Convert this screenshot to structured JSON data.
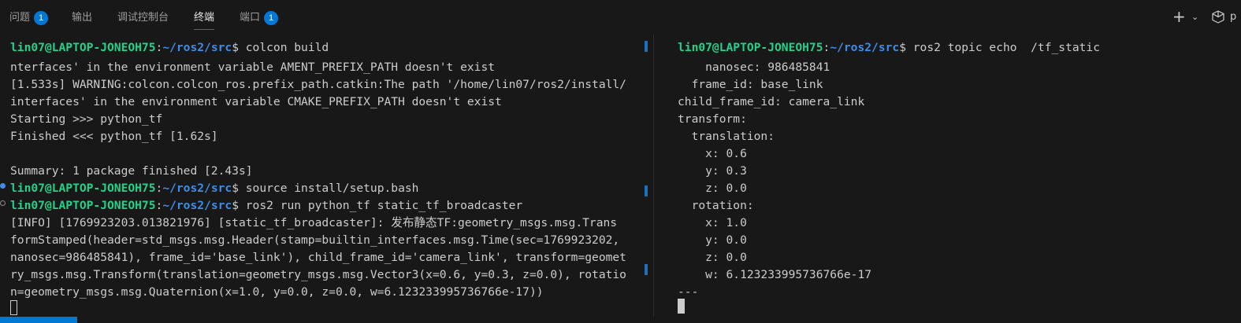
{
  "tabs": [
    {
      "label": "问题",
      "badge": "1"
    },
    {
      "label": "输出",
      "badge": null
    },
    {
      "label": "调试控制台",
      "badge": null
    },
    {
      "label": "终端",
      "badge": null,
      "active": true
    },
    {
      "label": "端口",
      "badge": "1"
    }
  ],
  "toolbar": {
    "add_icon": "plus-icon",
    "dropdown_icon": "chevron-down-icon",
    "shell_icon": "python-shell-icon",
    "truncated_label": "p"
  },
  "colors": {
    "accent": "#0078d4",
    "prompt_user": "#23d18b",
    "prompt_path": "#3b8eea",
    "bg": "#181818"
  },
  "left_terminal": {
    "prompt_header": {
      "user": "lin07@LAPTOP-JONEOH75",
      "path": "~/ros2/src",
      "symbol": "$",
      "command": " colcon build"
    },
    "lines": [
      "nterfaces' in the environment variable AMENT_PREFIX_PATH doesn't exist",
      "[1.533s] WARNING:colcon.colcon_ros.prefix_path.catkin:The path '/home/lin07/ros2/install/",
      "interfaces' in the environment variable CMAKE_PREFIX_PATH doesn't exist",
      "Starting >>> python_tf",
      "Finished <<< python_tf [1.62s]",
      "",
      "Summary: 1 package finished [2.43s]"
    ],
    "prompt_source": {
      "user": "lin07@LAPTOP-JONEOH75",
      "path": "~/ros2/src",
      "symbol": "$",
      "command": " source install/setup.bash"
    },
    "prompt_run": {
      "user": "lin07@LAPTOP-JONEOH75",
      "path": "~/ros2/src",
      "symbol": "$",
      "command": " ros2 run python_tf static_tf_broadcaster"
    },
    "output_lines": [
      "[INFO] [1769923203.013821976] [static_tf_broadcaster]: 发布静态TF:geometry_msgs.msg.Trans",
      "formStamped(header=std_msgs.msg.Header(stamp=builtin_interfaces.msg.Time(sec=1769923202,",
      "nanosec=986485841), frame_id='base_link'), child_frame_id='camera_link', transform=geomet",
      "ry_msgs.msg.Transform(translation=geometry_msgs.msg.Vector3(x=0.6, y=0.3, z=0.0), rotatio",
      "n=geometry_msgs.msg.Quaternion(x=1.0, y=0.0, z=0.0, w=6.123233995736766e-17))"
    ]
  },
  "right_terminal": {
    "prompt_header": {
      "user": "lin07@LAPTOP-JONEOH75",
      "path": "~/ros2/src",
      "symbol": "$",
      "command": " ros2 topic echo  /tf_static"
    },
    "lines": [
      "    nanosec: 986485841",
      "  frame_id: base_link",
      "child_frame_id: camera_link",
      "transform:",
      "  translation:",
      "    x: 0.6",
      "    y: 0.3",
      "    z: 0.0",
      "  rotation:",
      "    x: 1.0",
      "    y: 0.0",
      "    z: 0.0",
      "    w: 6.123233995736766e-17",
      "---"
    ]
  }
}
